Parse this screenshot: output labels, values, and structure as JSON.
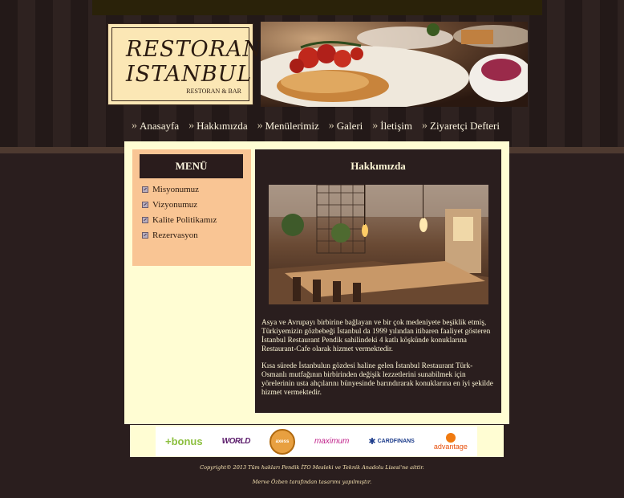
{
  "logo": {
    "line1": "RESTORAN",
    "line2": "ISTANBUL",
    "sub": "RESTORAN & BAR"
  },
  "nav": [
    {
      "label": "Anasayfa"
    },
    {
      "label": "Hakkımızda"
    },
    {
      "label": "Menülerimiz"
    },
    {
      "label": "Galeri"
    },
    {
      "label": "İletişim"
    },
    {
      "label": "Ziyaretçi Defteri"
    }
  ],
  "sidebar": {
    "title": "MENÜ",
    "items": [
      {
        "label": "Misyonumuz"
      },
      {
        "label": "Vizyonumuz"
      },
      {
        "label": "Kalite Politikamız"
      },
      {
        "label": "Rezervasyon"
      }
    ]
  },
  "main": {
    "title": "Hakkımızda",
    "paragraph1": "Asya ve Avrupayı birbirine bağlayan ve bir çok medeniyete beşiklik etmiş, Türkiyemizin gözbebeği İstanbul da 1999 yılından itibaren faaliyet gösteren İstanbul Restaurant Pendik sahilindeki 4 katlı köşkünde konuklarına Restaurant-Cafe olarak hizmet vermektedir.",
    "paragraph2": "Kısa sürede İstanbulun gözdesi haline gelen İstanbul Restaurant Türk-Osmanlı mutfağının birbirinden değişik lezzetlerini sunabilmek için yörelerinin usta ahçılarını bünyesinde barındırarak konuklarına en iyi şekilde hizmet vermektedir."
  },
  "sponsors": {
    "bonus": "+bonus",
    "world": "WORLD",
    "axess": "axess",
    "maximum": "maximum",
    "cardfinans": "CARDFINANS",
    "advantage": "advantage"
  },
  "footer": {
    "line1": "Copyright© 2013 Tüm hakları Pendik İTO Mesleki ve Teknik Anadolu Lisesi'ne aittir.",
    "line2": "Merve Özben tarafından tasarımı yapılmıştır."
  },
  "colors": {
    "cream": "#fffdd3",
    "peach": "#f9c594",
    "dark": "#2a1e1e",
    "text_light": "#fdf6d6"
  }
}
